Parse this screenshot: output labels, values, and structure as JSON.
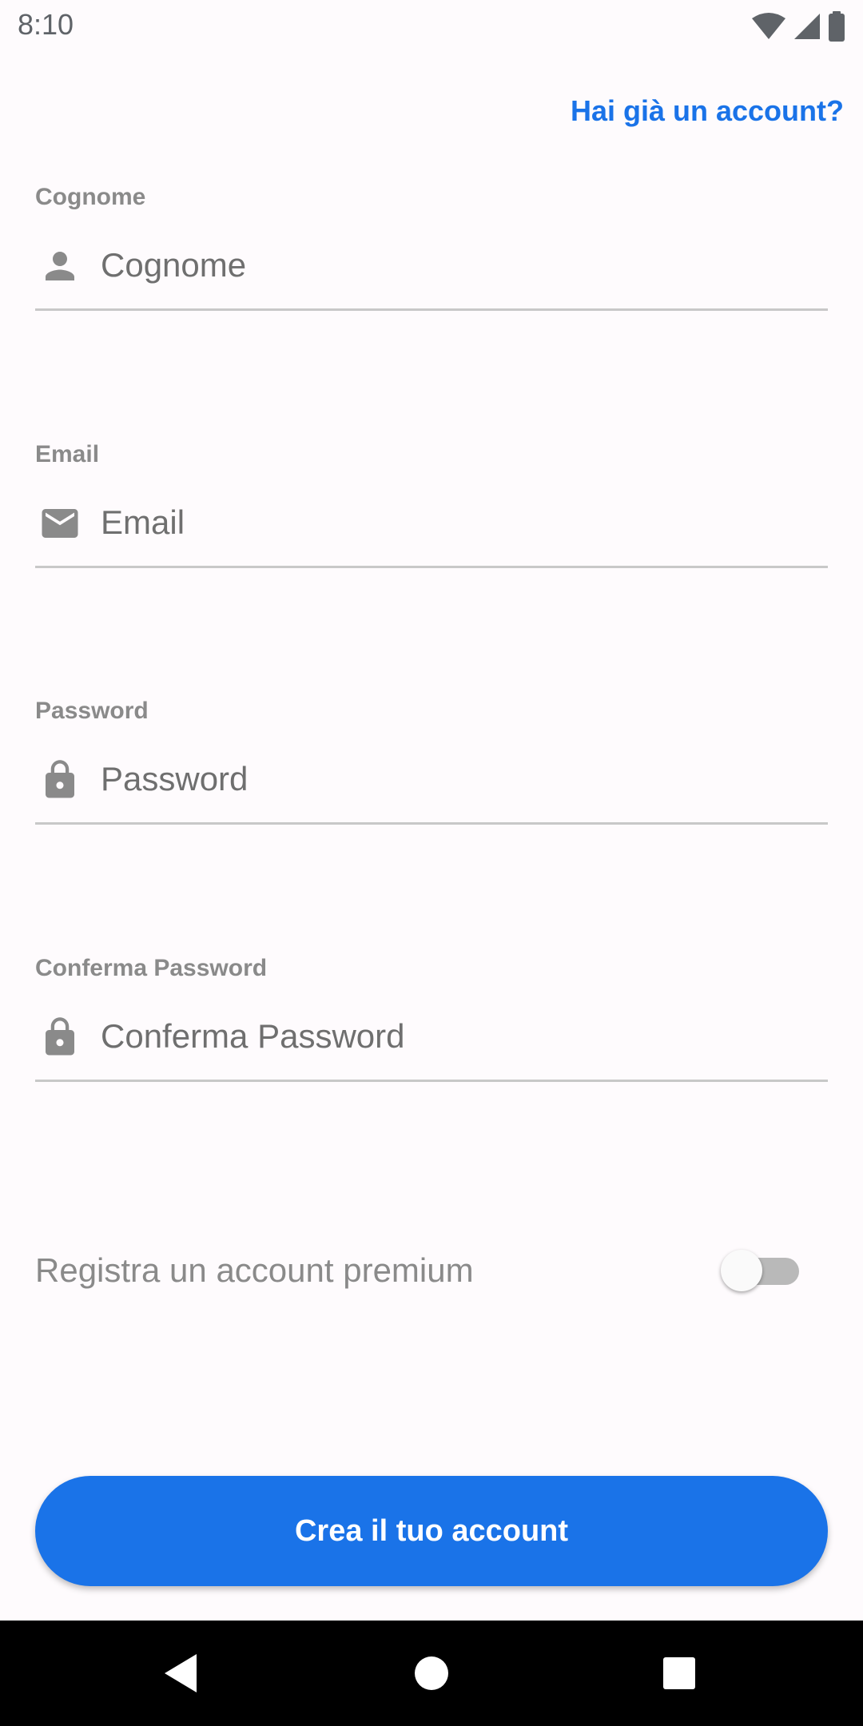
{
  "status_bar": {
    "time": "8:10",
    "icons": [
      "wifi-icon",
      "cellular-signal-icon",
      "battery-icon"
    ]
  },
  "header": {
    "signin_link": "Hai già un account?"
  },
  "form": {
    "surname": {
      "label": "Cognome",
      "placeholder": "Cognome",
      "icon": "person-icon"
    },
    "email": {
      "label": "Email",
      "placeholder": "Email",
      "icon": "mail-icon"
    },
    "password": {
      "label": "Password",
      "placeholder": "Password",
      "icon": "lock-icon"
    },
    "confirm_password": {
      "label": "Conferma Password",
      "placeholder": "Conferma Password",
      "icon": "lock-icon"
    },
    "premium": {
      "label": "Registra un account premium",
      "enabled": false
    },
    "submit_label": "Crea il tuo account"
  },
  "nav_bar": {
    "buttons": [
      "back-icon",
      "home-icon",
      "recents-icon"
    ]
  },
  "colors": {
    "accent": "#1a73e8",
    "background": "#fefbfd",
    "label_gray": "#8a8a8a",
    "divider": "#c8c8c8"
  }
}
